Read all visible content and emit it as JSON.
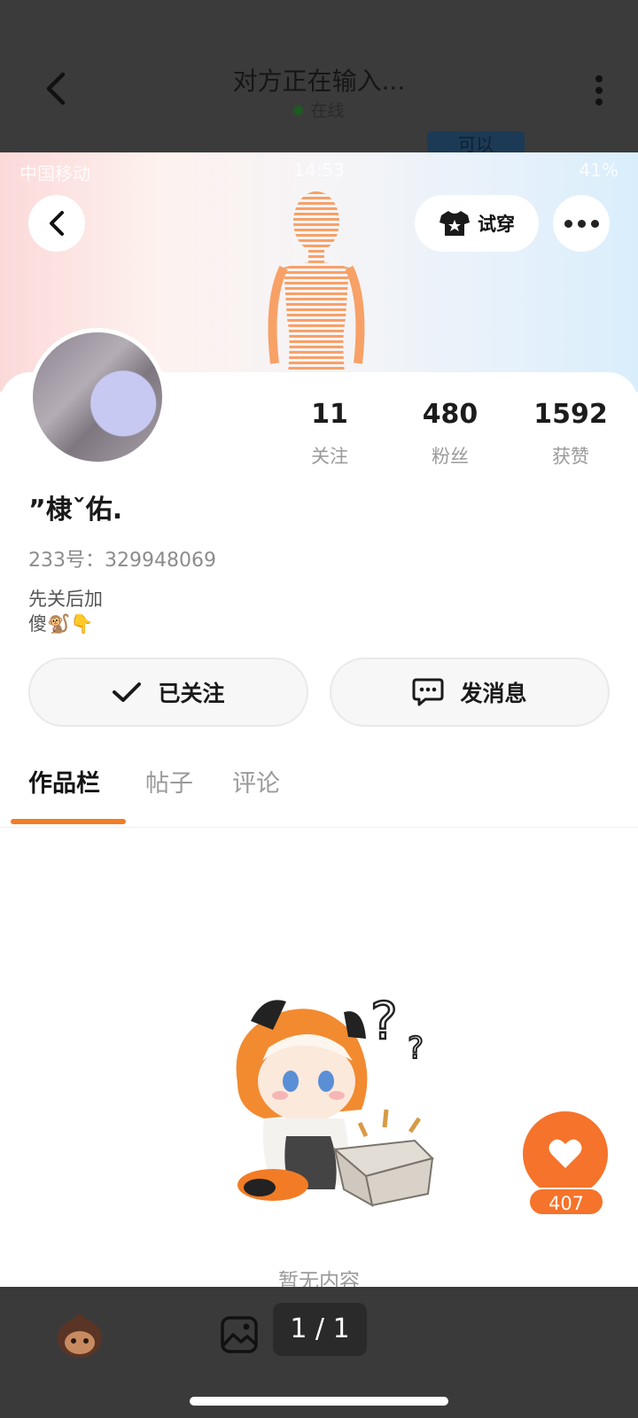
{
  "chat_header": {
    "title": "对方正在输入...",
    "status": "在线",
    "peek_text": "可以"
  },
  "status_bar": {
    "left": "中国移动",
    "time": "14:53",
    "right": "41%"
  },
  "profile": {
    "tryon_label": "试穿",
    "stats": [
      {
        "value": "11",
        "label": "关注"
      },
      {
        "value": "480",
        "label": "粉丝"
      },
      {
        "value": "1592",
        "label": "获赞"
      }
    ],
    "name": "”棣ˇ佑.",
    "uid": "233号：329948069",
    "bio_line1": "先关后加",
    "bio_line2": "傻🐒👇"
  },
  "actions": {
    "followed_label": "已关注",
    "message_label": "发消息"
  },
  "tabs": [
    {
      "label": "作品栏",
      "active": true
    },
    {
      "label": "帖子",
      "active": false
    },
    {
      "label": "评论",
      "active": false
    }
  ],
  "empty_state": {
    "text": "暂无内容"
  },
  "like": {
    "count": "407"
  },
  "viewer": {
    "page": "1 / 1"
  },
  "colors": {
    "accent": "#f5732a",
    "tab_indicator": "#f27c25",
    "dim_bg": "#3a3a3a"
  }
}
